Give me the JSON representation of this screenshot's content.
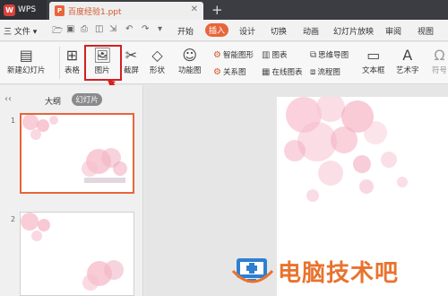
{
  "app": {
    "wps_label": "WPS",
    "doc_title": "百度经验1.ppt"
  },
  "menu": {
    "file_label": "三 文件 ▾"
  },
  "tabs": [
    "开始",
    "插入",
    "设计",
    "切换",
    "动画",
    "幻灯片放映",
    "审阅",
    "视图"
  ],
  "active_tab": "插入",
  "toolbar": {
    "new_slide": "新建幻灯片",
    "table": "表格",
    "picture": "图片",
    "screenshot": "截屏",
    "shape": "形状",
    "icons": "功能图",
    "smart_shape": "智能图形",
    "chart": "图表",
    "mind_map": "思维导图",
    "relation": "关系图",
    "online_chart": "在线图表",
    "flowchart": "流程图",
    "textbox": "文本框",
    "wordart": "艺术字",
    "symbol": "符号"
  },
  "pane": {
    "outline_tab": "大纲",
    "slides_tab": "幻灯片",
    "slide_numbers": [
      "1",
      "2"
    ]
  },
  "watermark": {
    "text": "电脑技术吧"
  },
  "colors": {
    "accent": "#e8653a",
    "highlight": "#d32020",
    "titlebar": "#3c3d42"
  }
}
